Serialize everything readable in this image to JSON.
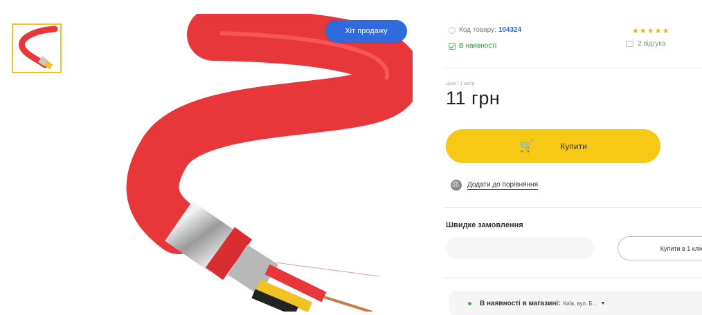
{
  "gallery": {
    "badge": "Хіт продажу"
  },
  "product": {
    "code_label": "Код товару:",
    "code_value": "104324",
    "stock_status": "В наявності",
    "rating": "★★★★★",
    "reviews": "2 відгука",
    "price_label": "Ціна / 1 метр",
    "price": "11 грн"
  },
  "actions": {
    "buy_label": "Купити",
    "cart_icon": "🛒",
    "compare_label": "Додати до порівняння"
  },
  "quick_order": {
    "title": "Швидке замовлення",
    "phone_placeholder": "",
    "button_label": "Купити в 1 клік"
  },
  "availability": {
    "label": "В наявності в магазині:",
    "store": "Київ, вул. Б...",
    "caret": "▼"
  },
  "colors": {
    "accent_yellow": "#f6c915",
    "badge_blue": "#2f6bdd",
    "cable_red": "#e8373a"
  }
}
